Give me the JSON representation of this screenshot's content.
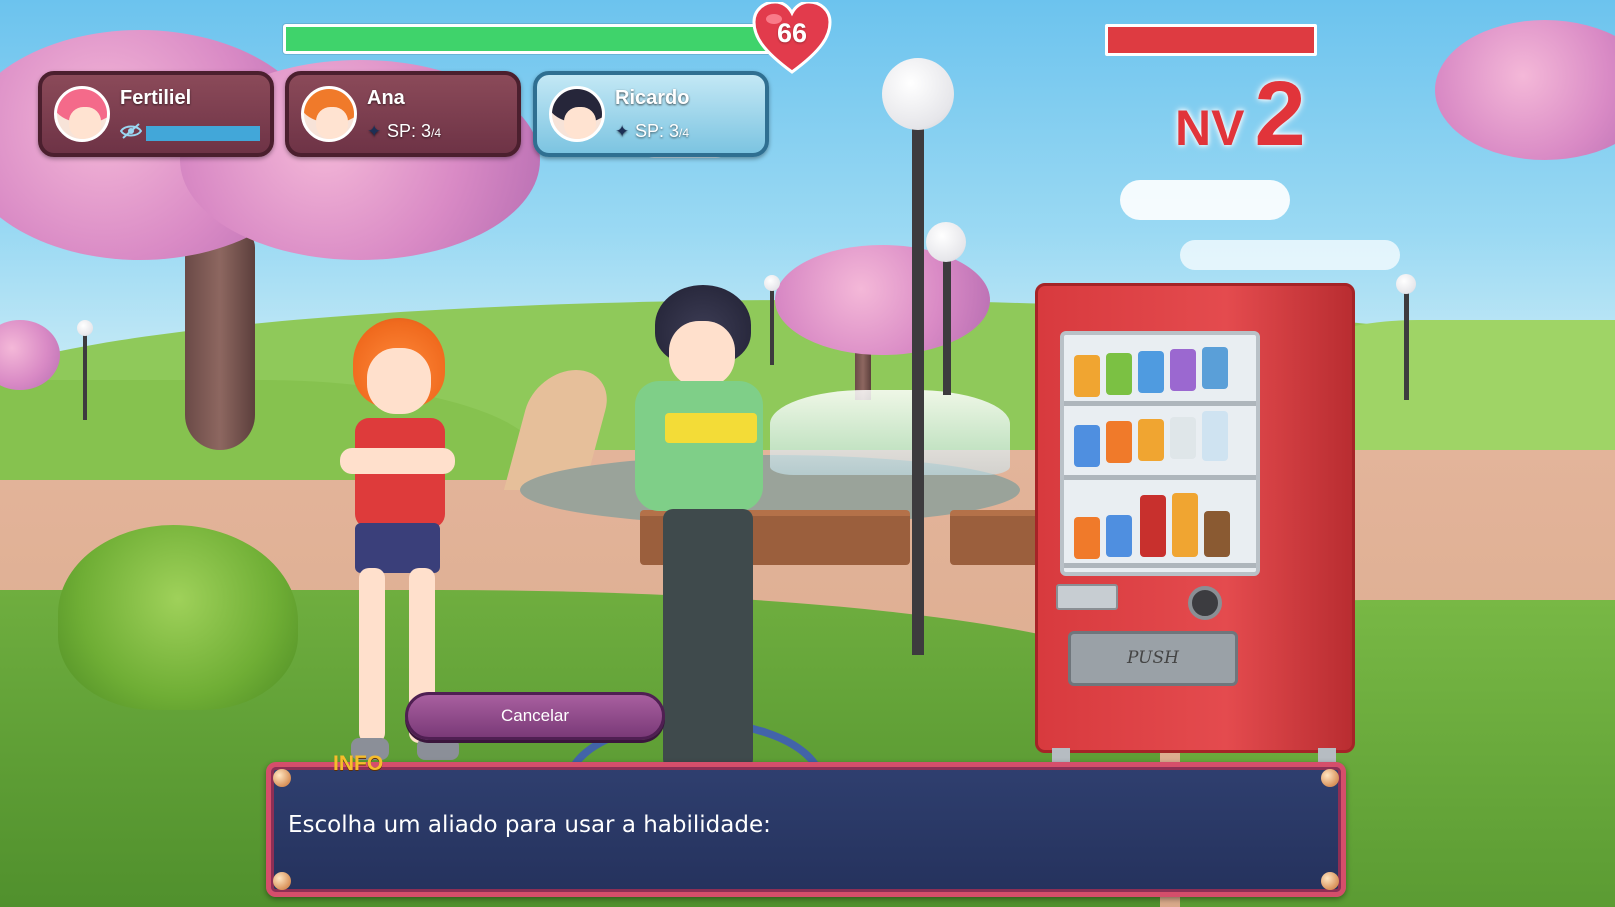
{
  "player": {
    "hp": 66,
    "hp_fraction": 1.0
  },
  "enemy": {
    "hp_fraction": 1.0,
    "level_prefix": "NV",
    "level": "2"
  },
  "party": [
    {
      "name": "Fertiliel",
      "status_icon": "blind-eye-icon",
      "mp_fraction": 1.0,
      "hair_color": "#f46a8a"
    },
    {
      "name": "Ana",
      "sp_label": "SP: 3",
      "sp_max": "/4",
      "hair_color": "#f07a2a"
    },
    {
      "name": "Ricardo",
      "sp_label": "SP: 3",
      "sp_max": "/4",
      "hair_color": "#26263a",
      "active": true
    }
  ],
  "vending_machine": {
    "push_label": "PUSH"
  },
  "cancel_button": {
    "label": "Cancelar"
  },
  "dialog": {
    "tag": "INFO",
    "text": "Escolha um aliado para usar a habilidade:"
  },
  "colors": {
    "hp_green": "#3fd36b",
    "enemy_red": "#de3b41",
    "level_red": "#e1343a",
    "info_gold": "#f6bd2c",
    "dialog_navy": "#2f3f6f"
  }
}
